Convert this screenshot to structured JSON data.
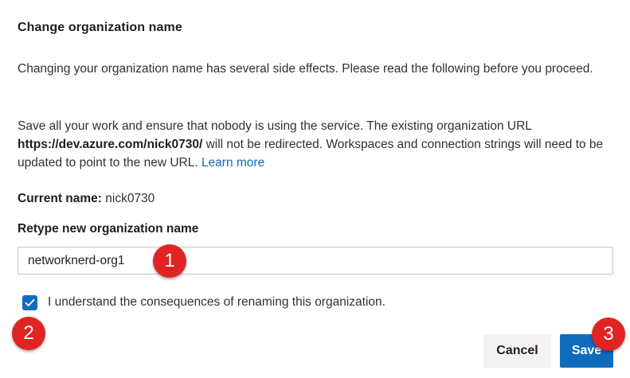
{
  "dialog": {
    "title": "Change organization name",
    "intro": "Changing your organization name has several side effects. Please read the following before you proceed.",
    "warning_before": "Save all your work and ensure that nobody is using the service. The existing organization URL ",
    "org_url": "https://dev.azure.com/nick0730/",
    "warning_after": " will not be redirected. Workspaces and connection strings will need to be updated to point to the new URL. ",
    "learn_more": "Learn more",
    "current_name_label": "Current name:",
    "current_name_value": "nick0730",
    "retype_label": "Retype new organization name",
    "new_name_value": "networknerd-org1",
    "checkbox_checked": true,
    "checkbox_label": "I understand the consequences of renaming this organization.",
    "cancel_label": "Cancel",
    "save_label": "Save"
  },
  "annotations": {
    "step1": "1",
    "step2": "2",
    "step3": "3"
  },
  "colors": {
    "accent": "#0f6cbd",
    "badge": "#e02424"
  }
}
